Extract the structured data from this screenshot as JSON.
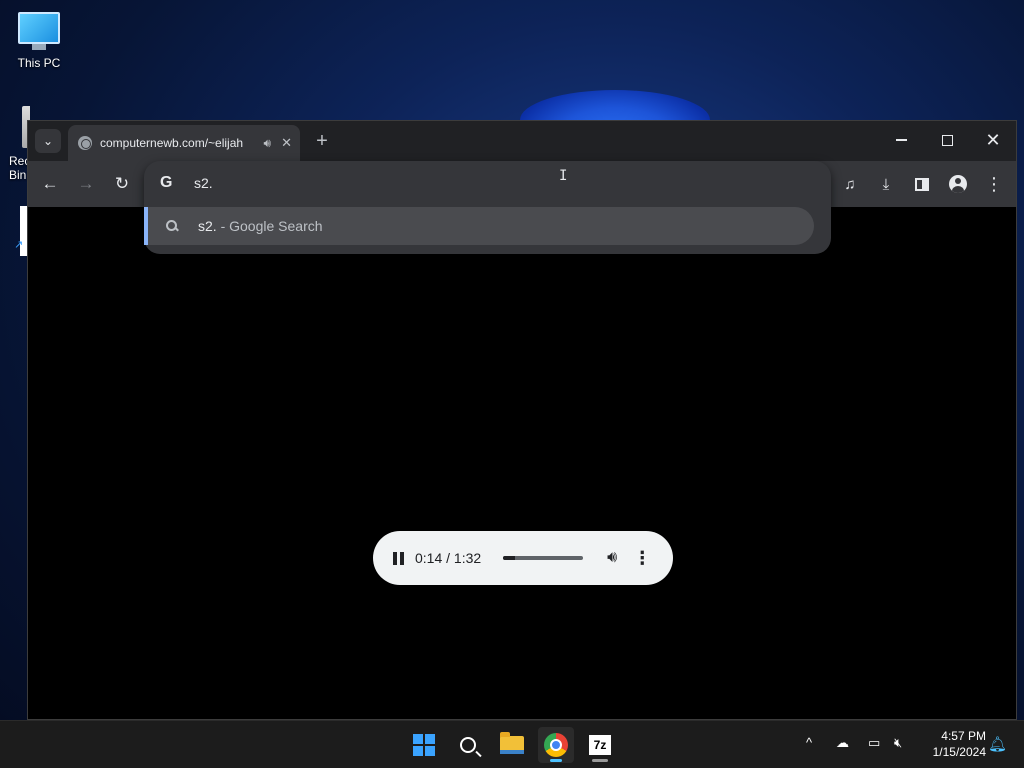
{
  "desktop": {
    "icons": [
      {
        "label": "This PC"
      },
      {
        "label": "Recycle Bin"
      }
    ]
  },
  "browser": {
    "tab": {
      "title": "computernewb.com/~elijah",
      "audio_icon": "speaker-icon",
      "close_icon": "close-icon"
    },
    "new_tab_icon": "plus-icon",
    "toolbar": {
      "back_icon": "arrow-left-icon",
      "forward_icon": "arrow-right-icon",
      "reload_icon": "reload-icon",
      "right_icons": [
        "media-control-icon",
        "download-icon",
        "side-panel-icon",
        "profile-icon",
        "menu-icon"
      ]
    },
    "omnibox": {
      "search_engine_glyph": "G",
      "value": "s2.",
      "suggestion": {
        "query": "s2.",
        "suffix": " - Google Search"
      }
    },
    "player": {
      "current_time": "0:14",
      "separator": " / ",
      "duration": "1:32",
      "progress_fraction": 0.15
    }
  },
  "taskbar": {
    "apps": [
      "start-icon",
      "search-icon",
      "file-explorer-icon",
      "chrome-icon",
      "7zip-icon"
    ],
    "zip_label": "7z",
    "clock_time": "4:57 PM",
    "clock_date": "1/15/2024"
  },
  "colors": {
    "accent": "#8ab4f8",
    "chrome_toolbar": "#35363a",
    "titlebar": "#202124"
  }
}
